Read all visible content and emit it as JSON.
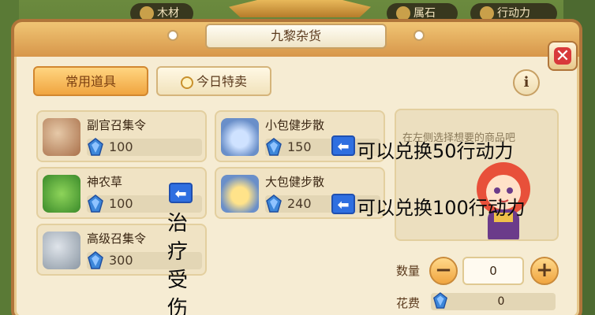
{
  "top_bar": {
    "wood_label": "木材",
    "stone_label": "属石",
    "action_label": "行动力"
  },
  "shop": {
    "title": "九黎杂货",
    "close_glyph": "✕",
    "info_glyph": "i"
  },
  "tabs": {
    "common": "常用道具",
    "today": "今日特卖"
  },
  "items": [
    {
      "name": "副官召集令",
      "price": "100",
      "icon": "scroll-icon"
    },
    {
      "name": "小包健步散",
      "price": "150",
      "icon": "bowl-icon"
    },
    {
      "name": "神农草",
      "price": "100",
      "icon": "herb-icon"
    },
    {
      "name": "大包健步散",
      "price": "240",
      "icon": "bowl-icon"
    },
    {
      "name": "高级召集令",
      "price": "300",
      "icon": "scroll-icon"
    }
  ],
  "preview": {
    "hint": "在左侧选择想要的商品吧"
  },
  "purchase": {
    "qty_label": "数量",
    "qty_value": "0",
    "minus": "−",
    "plus": "+",
    "cost_label": "花费",
    "cost_value": "0"
  },
  "annotations": {
    "arrow_glyph": "⬅",
    "note_small": "可以兑换50行动力",
    "note_big": "可以兑换100行动力",
    "note_vertical": "治疗受伤"
  },
  "colors": {
    "accent": "#f0a540",
    "gem": "#3c86d9",
    "arrow": "#2f6fe0",
    "close": "#d8393b"
  }
}
